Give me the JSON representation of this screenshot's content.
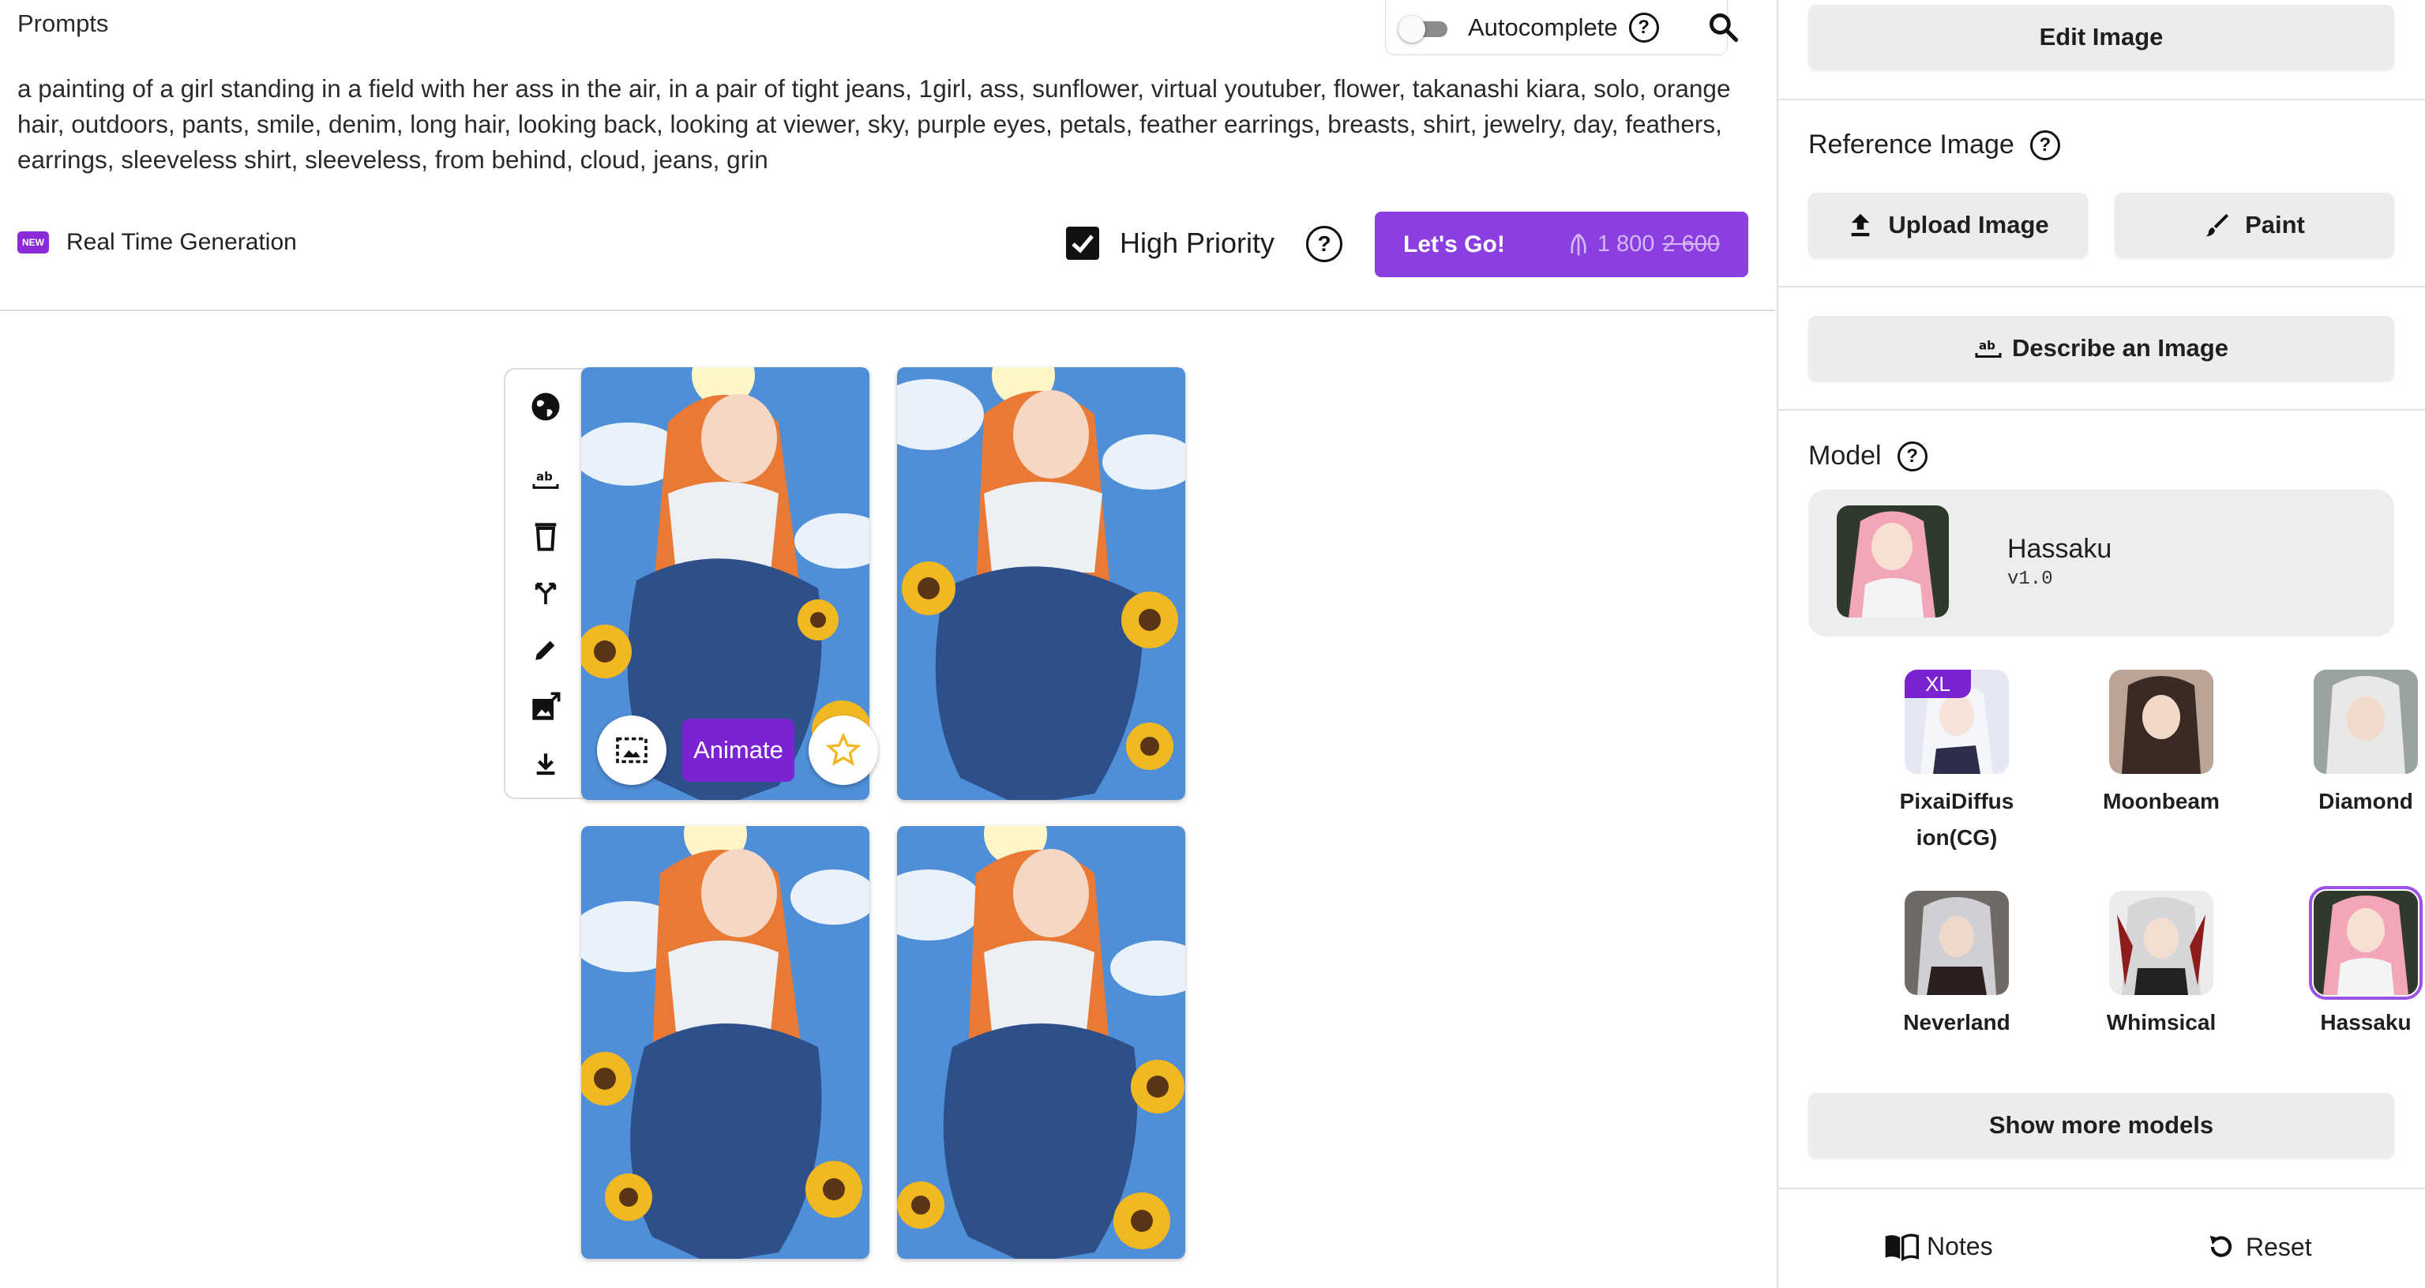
{
  "prompts": {
    "label": "Prompts",
    "autocomplete_label": "Autocomplete",
    "text": "a painting of a girl standing in a field with her ass in the air, in a pair of tight jeans, 1girl, ass, sunflower, virtual youtuber, flower, takanashi kiara, solo, orange hair, outdoors, pants, smile, denim, long hair, looking back, looking at viewer, sky, purple eyes, petals, feather earrings, breasts, shirt, jewelry, day, feathers, earrings, sleeveless shirt, sleeveless, from behind, cloud, jeans, grin"
  },
  "controls": {
    "new_badge": "NEW",
    "realtime_label": "Real Time Generation",
    "high_priority_label": "High Priority",
    "high_priority_checked": true,
    "go_label": "Let's Go!",
    "cost_current": "1 800",
    "cost_old": "2 600"
  },
  "gallery": {
    "animate_label": "Animate",
    "tools": [
      "globe-icon",
      "text-recognition-icon",
      "trash-icon",
      "branch-icon",
      "pencil-icon",
      "image-export-icon",
      "download-icon"
    ]
  },
  "sidebar": {
    "edit_image": "Edit Image",
    "reference_title": "Reference Image",
    "upload_image": "Upload Image",
    "paint": "Paint",
    "describe_image": "Describe an Image",
    "model_title": "Model",
    "selected_model": {
      "name": "Hassaku",
      "version": "v1.0"
    },
    "models": [
      {
        "name": "PixaiDiffusion(CG)",
        "badge": "XL",
        "selected": false
      },
      {
        "name": "Moonbeam",
        "badge": "",
        "selected": false
      },
      {
        "name": "Diamond",
        "badge": "",
        "selected": false
      },
      {
        "name": "Neverland",
        "badge": "",
        "selected": false
      },
      {
        "name": "Whimsical",
        "badge": "",
        "selected": false
      },
      {
        "name": "Hassaku",
        "badge": "",
        "selected": true
      }
    ],
    "show_more": "Show more models",
    "notes": "Notes",
    "reset": "Reset"
  },
  "colors": {
    "accent": "#8c3fe0",
    "animate": "#7b22d2",
    "sky": "#4f8fd8",
    "hair": "#e87a35",
    "denim": "#2d4f8a",
    "sunflower": "#f2b821"
  }
}
